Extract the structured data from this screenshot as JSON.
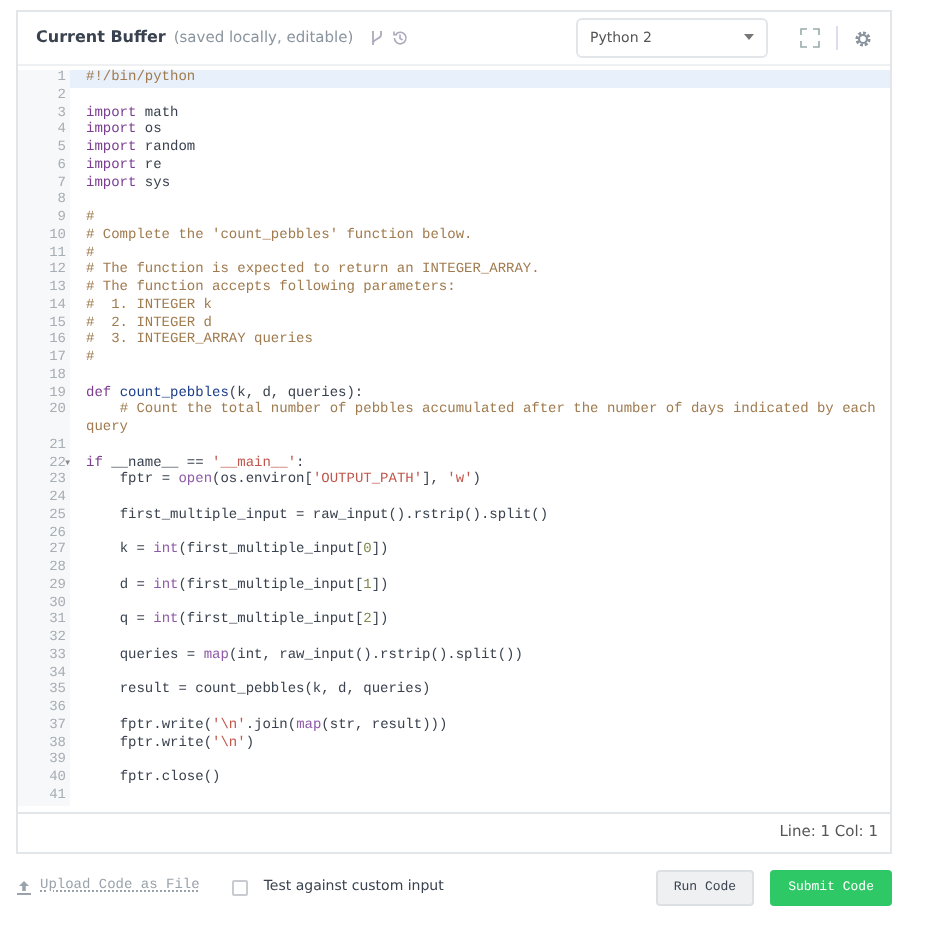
{
  "header": {
    "title": "Current Buffer",
    "subtitle": "(saved locally, editable)",
    "language": "Python 2"
  },
  "code_lines": [
    {
      "number": "1",
      "active": true,
      "tokens": [
        {
          "kind": "comment",
          "text": "#!/bin/python"
        }
      ]
    },
    {
      "number": "2",
      "active": false
    },
    {
      "number": "3",
      "active": false,
      "tokens": [
        {
          "kind": "keyword",
          "text": "import"
        },
        {
          "kind": "plain",
          "text": " math"
        }
      ]
    },
    {
      "number": "4",
      "active": false,
      "tokens": [
        {
          "kind": "keyword",
          "text": "import"
        },
        {
          "kind": "plain",
          "text": " os"
        }
      ]
    },
    {
      "number": "5",
      "active": false,
      "tokens": [
        {
          "kind": "keyword",
          "text": "import"
        },
        {
          "kind": "plain",
          "text": " random"
        }
      ]
    },
    {
      "number": "6",
      "active": false,
      "tokens": [
        {
          "kind": "keyword",
          "text": "import"
        },
        {
          "kind": "plain",
          "text": " re"
        }
      ]
    },
    {
      "number": "7",
      "active": false,
      "tokens": [
        {
          "kind": "keyword",
          "text": "import"
        },
        {
          "kind": "plain",
          "text": " sys"
        }
      ]
    },
    {
      "number": "8",
      "active": false
    },
    {
      "number": "9",
      "active": false,
      "tokens": [
        {
          "kind": "comment",
          "text": "#"
        }
      ]
    },
    {
      "number": "10",
      "active": false,
      "tokens": [
        {
          "kind": "comment",
          "text": "# Complete the 'count_pebbles' function below."
        }
      ]
    },
    {
      "number": "11",
      "active": false,
      "tokens": [
        {
          "kind": "comment",
          "text": "#"
        }
      ]
    },
    {
      "number": "12",
      "active": false,
      "tokens": [
        {
          "kind": "comment",
          "text": "# The function is expected to return an INTEGER_ARRAY."
        }
      ]
    },
    {
      "number": "13",
      "active": false,
      "tokens": [
        {
          "kind": "comment",
          "text": "# The function accepts following parameters:"
        }
      ]
    },
    {
      "number": "14",
      "active": false,
      "tokens": [
        {
          "kind": "comment",
          "text": "#  1. INTEGER k"
        }
      ]
    },
    {
      "number": "15",
      "active": false,
      "tokens": [
        {
          "kind": "comment",
          "text": "#  2. INTEGER d"
        }
      ]
    },
    {
      "number": "16",
      "active": false,
      "tokens": [
        {
          "kind": "comment",
          "text": "#  3. INTEGER_ARRAY queries"
        }
      ]
    },
    {
      "number": "17",
      "active": false,
      "tokens": [
        {
          "kind": "comment",
          "text": "#"
        }
      ]
    },
    {
      "number": "18",
      "active": false
    },
    {
      "number": "19",
      "active": false,
      "tokens": [
        {
          "kind": "keyword",
          "text": "def "
        },
        {
          "kind": "definition",
          "text": "count_pebbles"
        },
        {
          "kind": "plain",
          "text": "(k, d, queries):"
        }
      ]
    },
    {
      "number": "20",
      "active": false,
      "tokens": [
        {
          "kind": "comment",
          "text": "    # Count the total number of pebbles accumulated after the number of days indicated by each query"
        }
      ]
    },
    {
      "number": "21",
      "active": false
    },
    {
      "number": "22",
      "active": false,
      "fold": "▾",
      "tokens": [
        {
          "kind": "keyword",
          "text": "if"
        },
        {
          "kind": "plain",
          "text": " __name__ == "
        },
        {
          "kind": "string",
          "text": "'__main__'"
        },
        {
          "kind": "plain",
          "text": ":"
        }
      ]
    },
    {
      "number": "23",
      "active": false,
      "tokens": [
        {
          "kind": "plain",
          "text": "    fptr = "
        },
        {
          "kind": "builtin",
          "text": "open"
        },
        {
          "kind": "plain",
          "text": "(os.environ["
        },
        {
          "kind": "string",
          "text": "'OUTPUT_PATH'"
        },
        {
          "kind": "plain",
          "text": "], "
        },
        {
          "kind": "string",
          "text": "'w'"
        },
        {
          "kind": "plain",
          "text": ")"
        }
      ]
    },
    {
      "number": "24",
      "active": false
    },
    {
      "number": "25",
      "active": false,
      "tokens": [
        {
          "kind": "plain",
          "text": "    first_multiple_input = raw_input().rstrip().split()"
        }
      ]
    },
    {
      "number": "26",
      "active": false
    },
    {
      "number": "27",
      "active": false,
      "tokens": [
        {
          "kind": "plain",
          "text": "    k = "
        },
        {
          "kind": "builtin",
          "text": "int"
        },
        {
          "kind": "plain",
          "text": "(first_multiple_input["
        },
        {
          "kind": "number",
          "text": "0"
        },
        {
          "kind": "plain",
          "text": "])"
        }
      ]
    },
    {
      "number": "28",
      "active": false
    },
    {
      "number": "29",
      "active": false,
      "tokens": [
        {
          "kind": "plain",
          "text": "    d = "
        },
        {
          "kind": "builtin",
          "text": "int"
        },
        {
          "kind": "plain",
          "text": "(first_multiple_input["
        },
        {
          "kind": "number",
          "text": "1"
        },
        {
          "kind": "plain",
          "text": "])"
        }
      ]
    },
    {
      "number": "30",
      "active": false
    },
    {
      "number": "31",
      "active": false,
      "tokens": [
        {
          "kind": "plain",
          "text": "    q = "
        },
        {
          "kind": "builtin",
          "text": "int"
        },
        {
          "kind": "plain",
          "text": "(first_multiple_input["
        },
        {
          "kind": "number",
          "text": "2"
        },
        {
          "kind": "plain",
          "text": "])"
        }
      ]
    },
    {
      "number": "32",
      "active": false
    },
    {
      "number": "33",
      "active": false,
      "tokens": [
        {
          "kind": "plain",
          "text": "    queries = "
        },
        {
          "kind": "builtin",
          "text": "map"
        },
        {
          "kind": "plain",
          "text": "(int, raw_input().rstrip().split())"
        }
      ]
    },
    {
      "number": "34",
      "active": false
    },
    {
      "number": "35",
      "active": false,
      "tokens": [
        {
          "kind": "plain",
          "text": "    result = count_pebbles(k, d, queries)"
        }
      ]
    },
    {
      "number": "36",
      "active": false
    },
    {
      "number": "37",
      "active": false,
      "tokens": [
        {
          "kind": "plain",
          "text": "    fptr.write("
        },
        {
          "kind": "string",
          "text": "'\\n'"
        },
        {
          "kind": "plain",
          "text": ".join("
        },
        {
          "kind": "builtin",
          "text": "map"
        },
        {
          "kind": "plain",
          "text": "(str, result)))"
        }
      ]
    },
    {
      "number": "38",
      "active": false,
      "tokens": [
        {
          "kind": "plain",
          "text": "    fptr.write("
        },
        {
          "kind": "string",
          "text": "'\\n'"
        },
        {
          "kind": "plain",
          "text": ")"
        }
      ]
    },
    {
      "number": "39",
      "active": false
    },
    {
      "number": "40",
      "active": false,
      "tokens": [
        {
          "kind": "plain",
          "text": "    fptr.close()"
        }
      ]
    },
    {
      "number": "41",
      "active": false
    }
  ],
  "status_bar": "Line: 1 Col: 1",
  "footer": {
    "upload_link": "Upload Code as File",
    "custom_input": {
      "label": "Test against custom input",
      "checked": false
    },
    "buttons": [
      {
        "label": "Run Code",
        "kind": "secondary"
      },
      {
        "label": "Submit Code",
        "kind": "primary"
      }
    ]
  }
}
